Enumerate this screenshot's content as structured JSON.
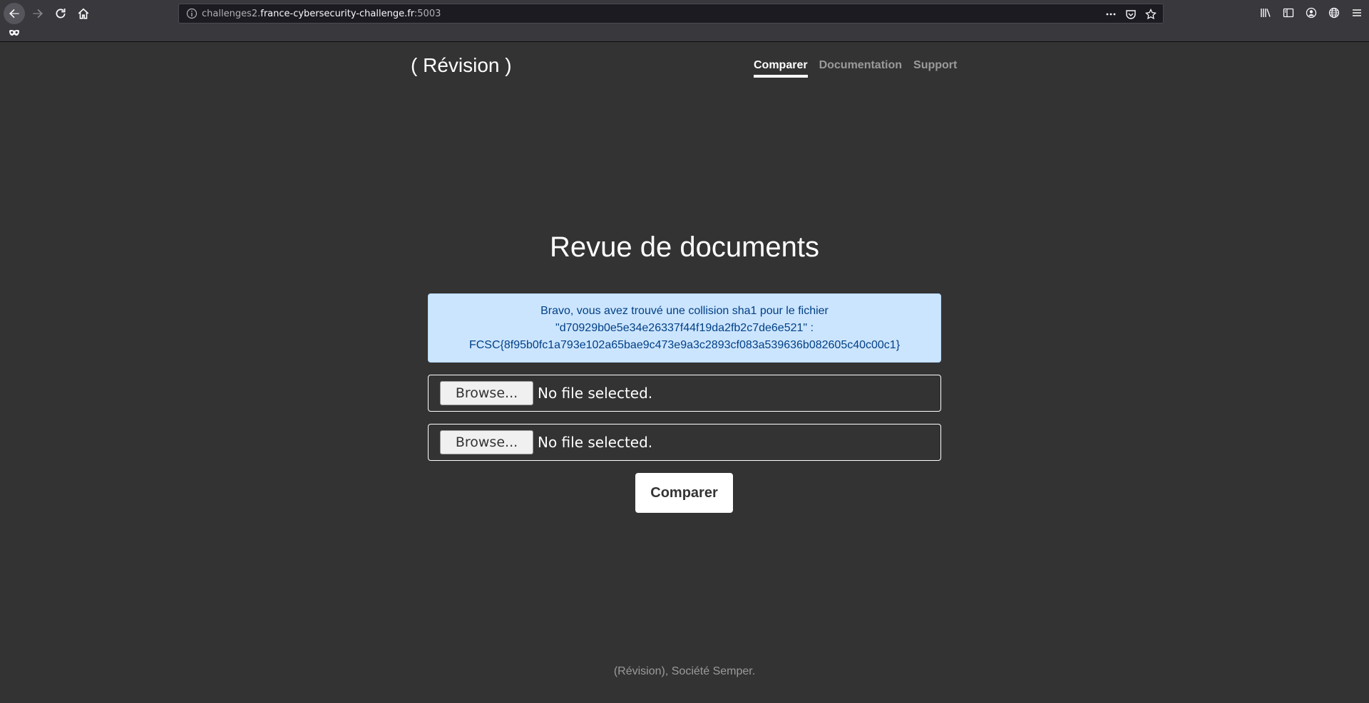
{
  "browser": {
    "url_prefix": "challenges2.",
    "url_domain": "france-cybersecurity-challenge.fr",
    "url_port": ":5003",
    "icons": {
      "back": "back-arrow-icon",
      "forward": "forward-arrow-icon",
      "reload": "reload-icon",
      "home": "home-icon",
      "site_info": "info-icon",
      "page_actions": "more-icon",
      "pocket": "pocket-icon",
      "bookmark": "star-icon",
      "library": "library-icon",
      "sidebar": "sidebar-icon",
      "account": "account-icon",
      "extension": "globe-icon",
      "menu": "hamburger-menu-icon",
      "private": "private-mask-icon"
    }
  },
  "site": {
    "brand": "( Révision )",
    "nav": [
      {
        "label": "Comparer",
        "active": true
      },
      {
        "label": "Documentation",
        "active": false
      },
      {
        "label": "Support",
        "active": false
      }
    ]
  },
  "main": {
    "heading": "Revue de documents",
    "alert": {
      "line1": "Bravo, vous avez trouvé une collision sha1 pour le fichier",
      "line2": "\"d70929b0e5e34e26337f44f19da2fb2c7de6e521\" :",
      "line3": "FCSC{8f95b0fc1a793e102a65bae9c473e9a3c2893cf083a539636b082605c40c00c1}"
    },
    "file_inputs": [
      {
        "button_label": "Browse...",
        "status": "No file selected."
      },
      {
        "button_label": "Browse...",
        "status": "No file selected."
      }
    ],
    "submit_label": "Comparer"
  },
  "footer": {
    "text": "(Révision), Société Semper."
  },
  "colors": {
    "page_background": "#333333",
    "alert_background": "#cce5ff",
    "alert_text": "#004085",
    "chrome_background": "#38383d"
  }
}
